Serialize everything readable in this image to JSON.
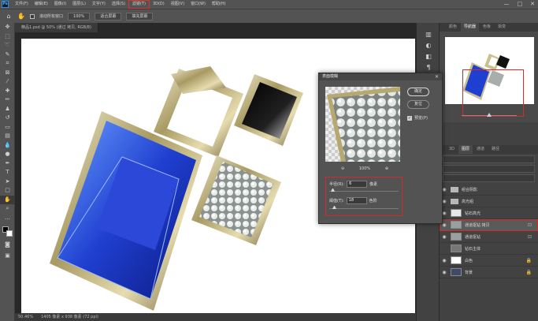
{
  "menubar": {
    "logo": "Ps",
    "items": [
      "文件(F)",
      "编辑(E)",
      "图像(I)",
      "图层(L)",
      "文字(Y)",
      "选择(S)",
      "滤镜(T)",
      "3D(D)",
      "视图(V)",
      "窗口(W)",
      "帮助(H)"
    ],
    "active_index": 6,
    "window_controls": [
      "—",
      "□",
      "✕"
    ]
  },
  "optionsbar": {
    "scroll_all_label": "滚动所有窗口",
    "zoom_value": "100%",
    "fit_screen_label": "适合屏幕",
    "fill_screen_label": "填充屏幕"
  },
  "document": {
    "tab_title": "精品1.psd @ 50% (通过 拷贝, RGB/8)",
    "status_zoom": "50.46%",
    "status_doc": "1405 像素 x 938 像素 (72 ppi)"
  },
  "panels": {
    "top_tabs": [
      "颜色",
      "导航器",
      "色板",
      "渐变"
    ],
    "top_active": 1,
    "layer_tabs": [
      "3D",
      "图层",
      "通道",
      "路径"
    ],
    "layer_active": 1,
    "layers": [
      {
        "name": "组合阴影",
        "type": "folder",
        "visible": true,
        "selected": false,
        "locked": false
      },
      {
        "name": "高光组",
        "type": "folder",
        "visible": true,
        "selected": false,
        "locked": false
      },
      {
        "name": "钻石高光",
        "type": "layer",
        "visible": true,
        "selected": false,
        "locked": false
      },
      {
        "name": "通道抠钻 拷贝",
        "type": "layer",
        "visible": true,
        "selected": true,
        "locked": false
      },
      {
        "name": "通道抠钻",
        "type": "layer",
        "visible": true,
        "selected": false,
        "locked": false
      },
      {
        "name": "钻石主体",
        "type": "layer",
        "visible": false,
        "selected": false,
        "locked": false
      },
      {
        "name": "白色",
        "type": "layer",
        "visible": true,
        "selected": false,
        "locked": true
      },
      {
        "name": "背景",
        "type": "layer",
        "visible": true,
        "selected": false,
        "locked": true
      }
    ]
  },
  "dialog": {
    "title": "表面模糊",
    "close": "✕",
    "ok_label": "确定",
    "cancel_label": "复位",
    "preview_label": "预览(P)",
    "preview_checked": true,
    "zoom_out": "⊖",
    "zoom_value": "100%",
    "zoom_in": "⊕",
    "radius_label": "半径(R):",
    "radius_value": "6",
    "radius_unit": "像素",
    "radius_fraction": 0.05,
    "threshold_label": "阈值(T):",
    "threshold_value": "18",
    "threshold_unit": "色阶",
    "threshold_fraction": 0.07
  },
  "colors": {
    "highlight_red": "#d12b2b",
    "blue_gem": "#1f3fd0",
    "gold": "#c9bf8f"
  }
}
